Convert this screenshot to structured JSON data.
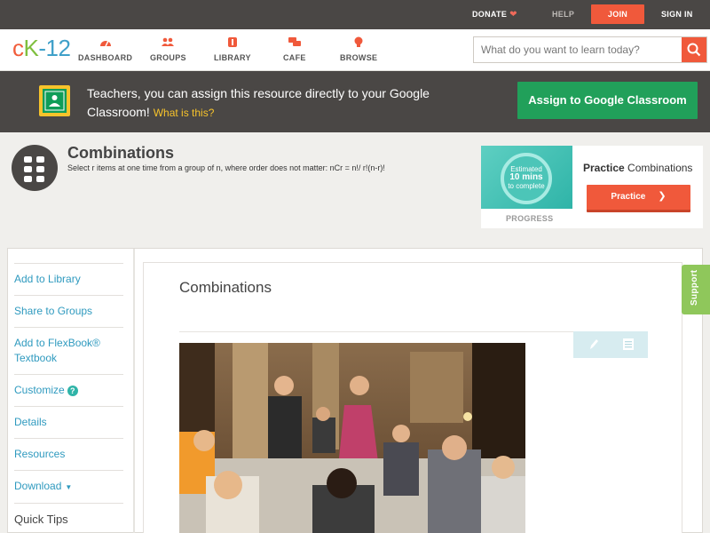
{
  "topbar": {
    "donate": "DONATE",
    "help": "HELP",
    "join": "JOIN",
    "signin": "SIGN IN"
  },
  "logo": {
    "part1": "c",
    "part2": "K",
    "part3": "-12"
  },
  "nav": [
    {
      "label": "DASHBOARD",
      "icon": "dashboard-gauge-icon"
    },
    {
      "label": "GROUPS",
      "icon": "groups-people-icon"
    },
    {
      "label": "LIBRARY",
      "icon": "library-book-icon"
    },
    {
      "label": "CAFE",
      "icon": "cafe-chat-icon"
    },
    {
      "label": "BROWSE",
      "icon": "browse-bulb-icon"
    }
  ],
  "search": {
    "placeholder": "What do you want to learn today?",
    "icon": "search-icon"
  },
  "banner": {
    "text": "Teachers, you can assign this resource directly to your Google Classroom!",
    "link": "What is this?",
    "button": "Assign to Google Classroom"
  },
  "concept": {
    "title": "Combinations",
    "description": "Select r items at one time from a group of n, where order does not matter: nCr = n!/ r!(n-r)!"
  },
  "practice": {
    "estimated": "Estimated",
    "minutes": "10 mins",
    "to_complete": "to complete",
    "progress_label": "PROGRESS",
    "title_bold": "Practice",
    "title_rest": "Combinations",
    "button": "Practice"
  },
  "sidebar": {
    "items": [
      {
        "label": "Add to Library"
      },
      {
        "label": "Share to Groups"
      },
      {
        "label": "Add to FlexBook® Textbook"
      },
      {
        "label": "Customize"
      },
      {
        "label": "Details"
      },
      {
        "label": "Resources"
      },
      {
        "label": "Download"
      },
      {
        "label": "Quick Tips"
      }
    ]
  },
  "main": {
    "title": "Combinations"
  },
  "support": "Support",
  "colors": {
    "accent": "#f0593b",
    "teal": "#2fb4a8",
    "link": "#2f9abf",
    "dark": "#4a4745",
    "green": "#21a05a"
  }
}
